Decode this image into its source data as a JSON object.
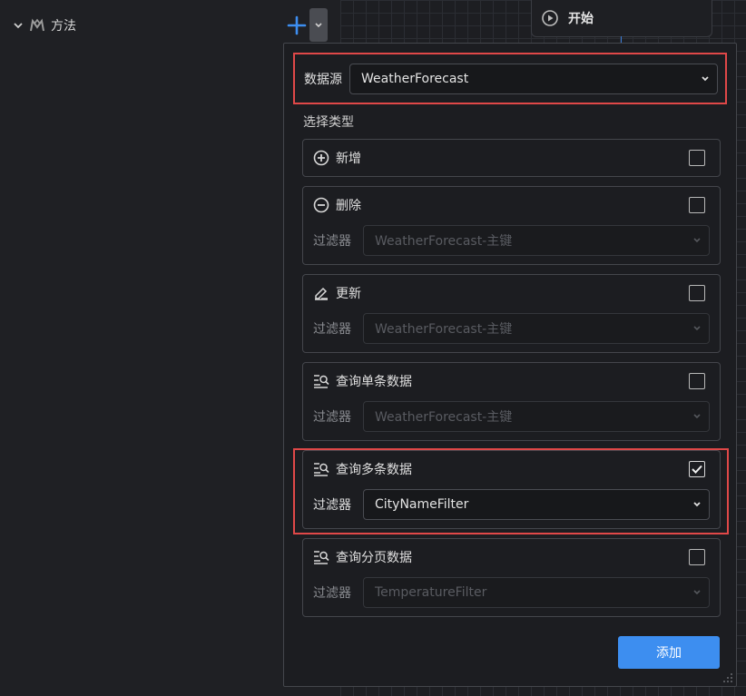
{
  "tree": {
    "label": "方法"
  },
  "canvas": {
    "start_node_label": "开始"
  },
  "panel": {
    "datasource_label": "数据源",
    "datasource_value": "WeatherForecast",
    "section_title": "选择类型",
    "filter_label": "过滤器",
    "add_button": "添加",
    "cards": [
      {
        "title": "新增",
        "icon": "plus-circle-icon",
        "checked": false
      },
      {
        "title": "删除",
        "icon": "minus-circle-icon",
        "checked": false,
        "filter": "WeatherForecast-主键"
      },
      {
        "title": "更新",
        "icon": "edit-icon",
        "checked": false,
        "filter": "WeatherForecast-主键"
      },
      {
        "title": "查询单条数据",
        "icon": "search-list-icon",
        "checked": false,
        "filter": "WeatherForecast-主键"
      },
      {
        "title": "查询多条数据",
        "icon": "search-list-icon",
        "checked": true,
        "filter": "CityNameFilter"
      },
      {
        "title": "查询分页数据",
        "icon": "search-list-icon",
        "checked": false,
        "filter": "TemperatureFilter"
      }
    ]
  },
  "colors": {
    "accent": "#3d8ef0",
    "highlight": "#e04848",
    "background": "#1f2024"
  }
}
